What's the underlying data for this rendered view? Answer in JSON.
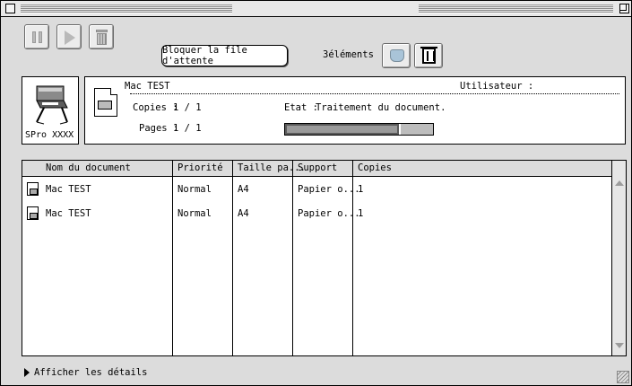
{
  "toolbar": {
    "pause_icon": "pause-icon",
    "resume_icon": "resume-icon",
    "trash_icon": "trash-icon",
    "hold_queue_label": "Bloquer la file d'attente",
    "item_count": "3éléments"
  },
  "printer": {
    "name": "SPro XXXX"
  },
  "job": {
    "document_name": "Mac TEST",
    "user_label": "Utilisateur :",
    "copies_label": "Copies :",
    "copies_value": "1 / 1",
    "pages_label": "Pages :",
    "pages_value": "1 / 1",
    "status_label": "Etat :",
    "status_value": "Traitement du document.",
    "progress_fraction": 0.78
  },
  "table": {
    "columns": [
      "Nom du document",
      "Priorité",
      "Taille pa...",
      "Support",
      "Copies"
    ],
    "rows": [
      {
        "name": "Mac TEST",
        "priority": "Normal",
        "size": "A4",
        "media": "Papier o...",
        "copies": "1"
      },
      {
        "name": "Mac TEST",
        "priority": "Normal",
        "size": "A4",
        "media": "Papier o...",
        "copies": "1"
      }
    ]
  },
  "footer": {
    "details_label": "Afficher les détails"
  }
}
